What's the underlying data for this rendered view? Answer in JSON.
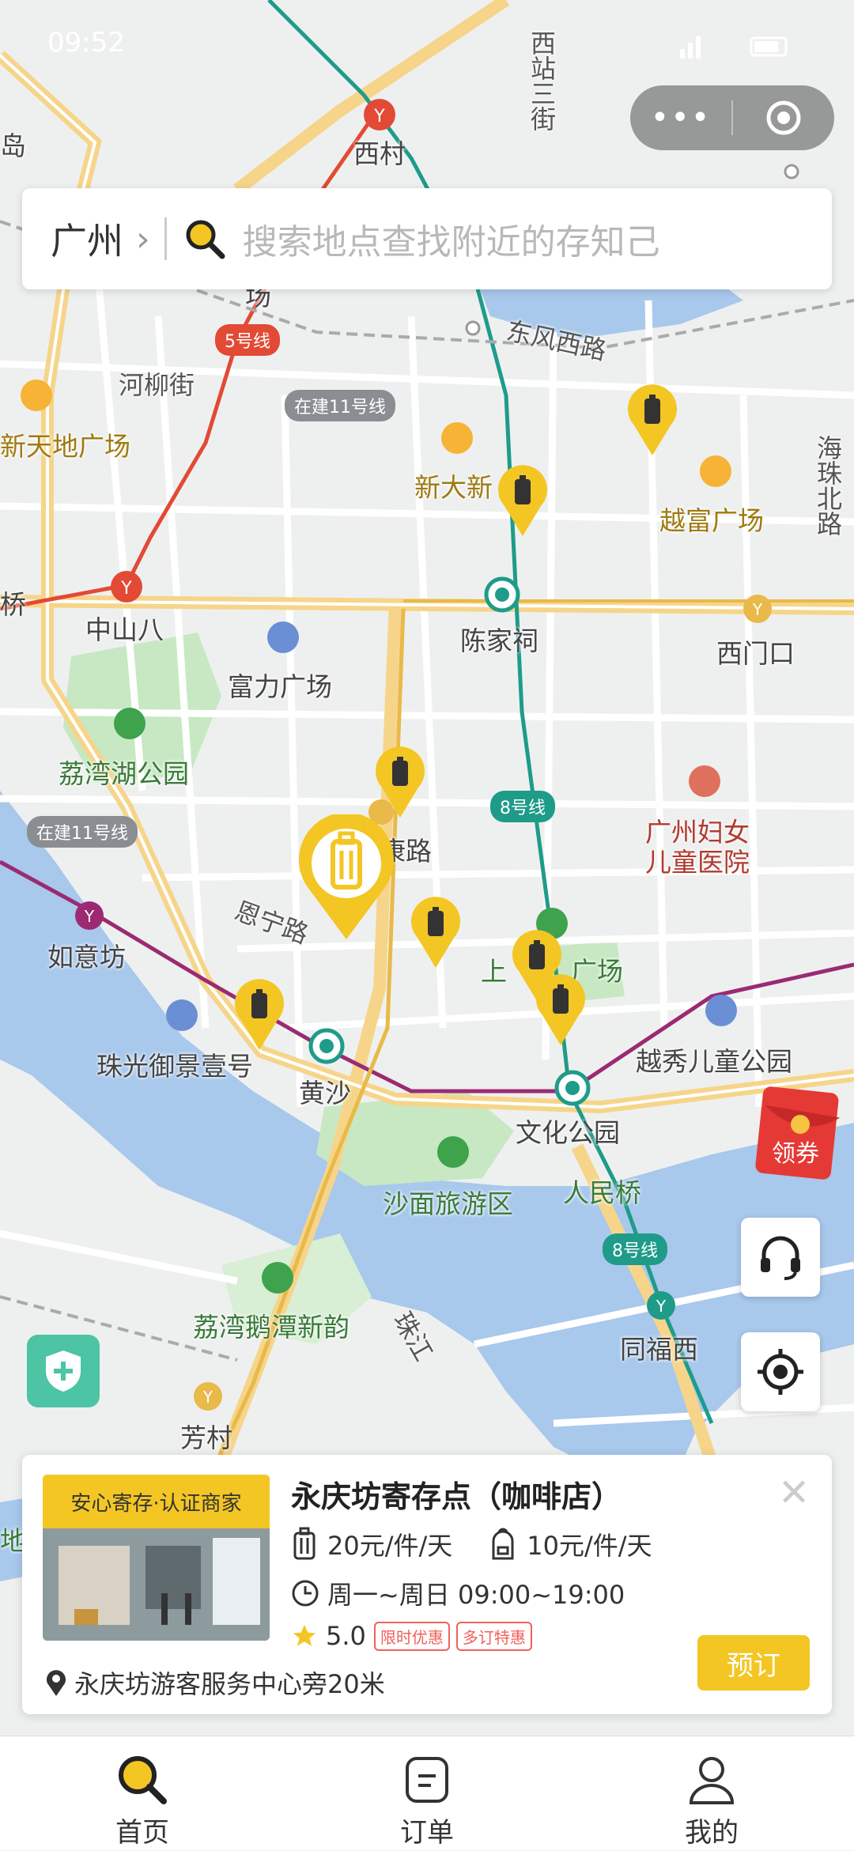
{
  "status_bar": {
    "time": "09:52"
  },
  "search": {
    "city": "广州",
    "placeholder": "搜索地点查找附近的存知己"
  },
  "map": {
    "labels": [
      {
        "text": "西村",
        "style": ""
      },
      {
        "text": "西站三街",
        "style": "road"
      },
      {
        "text": "东风西路",
        "style": "road"
      },
      {
        "text": "河柳街",
        "style": "road"
      },
      {
        "text": "新天地广场",
        "style": "gold"
      },
      {
        "text": "新大新",
        "style": "gold"
      },
      {
        "text": "越富广场",
        "style": "gold"
      },
      {
        "text": "海珠北路",
        "style": "road"
      },
      {
        "text": "中山八",
        "style": ""
      },
      {
        "text": "陈家祠",
        "style": ""
      },
      {
        "text": "西门口",
        "style": ""
      },
      {
        "text": "富力广场",
        "style": ""
      },
      {
        "text": "荔湾湖公园",
        "style": "green"
      },
      {
        "text": "广州妇女",
        "style": "red"
      },
      {
        "text": "儿童医院",
        "style": "red"
      },
      {
        "text": "康路",
        "style": ""
      },
      {
        "text": "恩宁路",
        "style": "road"
      },
      {
        "text": "如意坊",
        "style": ""
      },
      {
        "text": "上",
        "style": "green"
      },
      {
        "text": "广场",
        "style": "green"
      },
      {
        "text": "珠光御景壹号",
        "style": ""
      },
      {
        "text": "越秀儿童公园",
        "style": ""
      },
      {
        "text": "黄沙",
        "style": ""
      },
      {
        "text": "文化公园",
        "style": ""
      },
      {
        "text": "沙面旅游区",
        "style": "green"
      },
      {
        "text": "人民桥",
        "style": "green"
      },
      {
        "text": "荔湾鹅潭新韵",
        "style": "green"
      },
      {
        "text": "珠江",
        "style": "road"
      },
      {
        "text": "同福西",
        "style": ""
      },
      {
        "text": "芳村",
        "style": ""
      },
      {
        "text": "岛",
        "style": ""
      },
      {
        "text": "桥",
        "style": ""
      },
      {
        "text": "地",
        "style": "green"
      },
      {
        "text": "场",
        "style": ""
      }
    ],
    "line_badges": [
      {
        "text": "5号线",
        "color": "#e24a35"
      },
      {
        "text": "在建11号线",
        "color": "#8a8d91"
      },
      {
        "text": "8号线",
        "color": "#1f9b8a"
      },
      {
        "text": "在建11号线",
        "color": "#8a8d91"
      },
      {
        "text": "8号线",
        "color": "#1f9b8a"
      }
    ]
  },
  "coupon": {
    "label": "领券"
  },
  "store_card": {
    "tag": "安心寄存·认证商家",
    "name": "永庆坊寄存点（咖啡店）",
    "price_suitcase": "20元/件/天",
    "price_backpack": "10元/件/天",
    "hours": "周一~周日 09:00~19:00",
    "rating": "5.0",
    "chips": [
      "限时优惠",
      "多订特惠"
    ],
    "book_label": "预订",
    "address": "永庆坊游客服务中心旁20米"
  },
  "tabs": [
    {
      "label": "首页",
      "icon": "search-icon",
      "active": true
    },
    {
      "label": "订单",
      "icon": "order-icon",
      "active": false
    },
    {
      "label": "我的",
      "icon": "profile-icon",
      "active": false
    }
  ],
  "colors": {
    "accent": "#f3c623",
    "water": "#a8c8ec",
    "park": "#c7e8c3",
    "line5": "#e24a35",
    "line8": "#1f9b8a",
    "line1": "#e9b949",
    "line6": "#9b2a73"
  }
}
